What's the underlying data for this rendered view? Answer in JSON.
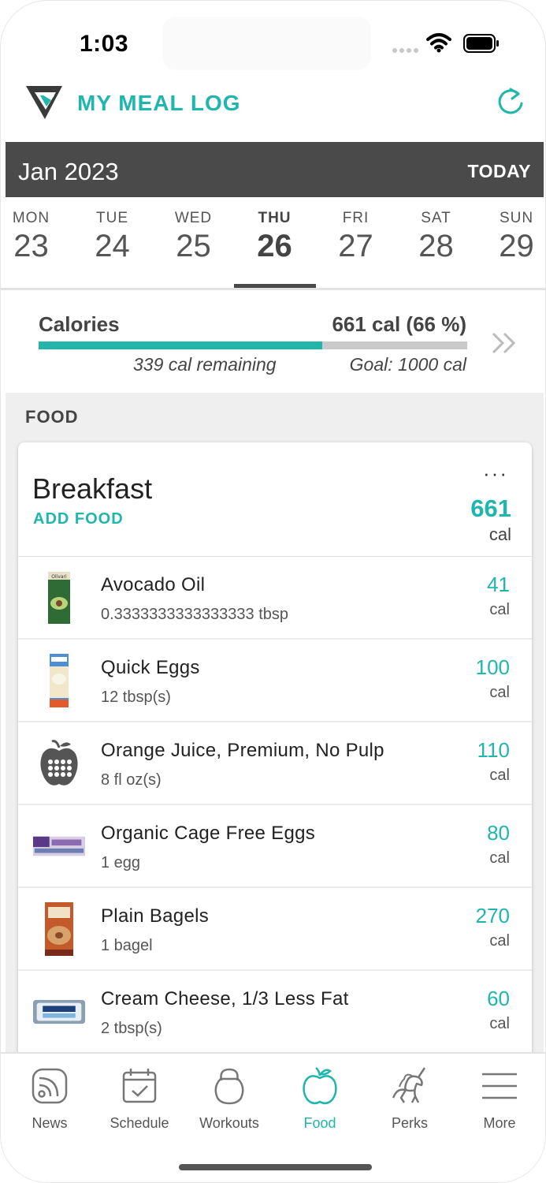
{
  "status": {
    "time": "1:03"
  },
  "header": {
    "title": "MY MEAL LOG"
  },
  "month": {
    "label": "Jan 2023",
    "today": "TODAY"
  },
  "week": [
    {
      "name": "MON",
      "num": "23"
    },
    {
      "name": "TUE",
      "num": "24"
    },
    {
      "name": "WED",
      "num": "25"
    },
    {
      "name": "THU",
      "num": "26",
      "selected": true
    },
    {
      "name": "FRI",
      "num": "27"
    },
    {
      "name": "SAT",
      "num": "28"
    },
    {
      "name": "SUN",
      "num": "29"
    }
  ],
  "calories": {
    "label": "Calories",
    "value": "661 cal (66 %)",
    "progress": 0.661,
    "remaining": "339 cal remaining",
    "goal": "Goal: 1000 cal"
  },
  "food": {
    "heading": "FOOD",
    "meal": {
      "title": "Breakfast",
      "add_food": "ADD FOOD",
      "more": "···",
      "cal": "661",
      "cal_unit": "cal",
      "items": [
        {
          "name": "Avocado Oil",
          "serving": "0.3333333333333333 tbsp",
          "cal": "41",
          "unit": "cal",
          "thumb": "avocado-oil-bottle"
        },
        {
          "name": "Quick Eggs",
          "serving": "12 tbsp(s)",
          "cal": "100",
          "unit": "cal",
          "thumb": "quick-eggs-carton"
        },
        {
          "name": "Orange Juice, Premium, No Pulp",
          "serving": "8 fl oz(s)",
          "cal": "110",
          "unit": "cal",
          "thumb": "apple-calculator-icon"
        },
        {
          "name": "Organic Cage Free Eggs",
          "serving": "1 egg",
          "cal": "80",
          "unit": "cal",
          "thumb": "egg-carton"
        },
        {
          "name": "Plain Bagels",
          "serving": "1 bagel",
          "cal": "270",
          "unit": "cal",
          "thumb": "bagel-bag"
        },
        {
          "name": "Cream Cheese, 1/3 Less Fat",
          "serving": "2 tbsp(s)",
          "cal": "60",
          "unit": "cal",
          "thumb": "cream-cheese-tub"
        }
      ]
    }
  },
  "nav": [
    {
      "label": "News",
      "icon": "news-rss-icon"
    },
    {
      "label": "Schedule",
      "icon": "calendar-check-icon"
    },
    {
      "label": "Workouts",
      "icon": "kettlebell-icon"
    },
    {
      "label": "Food",
      "icon": "apple-icon",
      "active": true
    },
    {
      "label": "Perks",
      "icon": "unicorn-icon"
    },
    {
      "label": "More",
      "icon": "menu-icon"
    }
  ],
  "colors": {
    "accent": "#1fb6ad",
    "dark_bar": "#4a4a4a",
    "section_bg": "#efefef"
  }
}
